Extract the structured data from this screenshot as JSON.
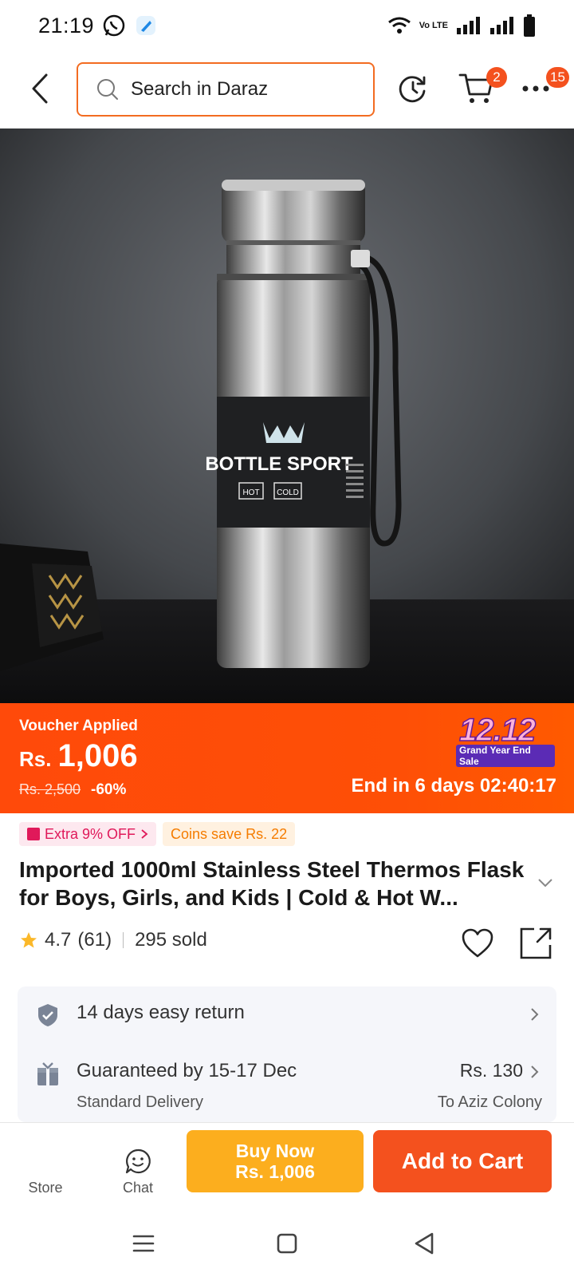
{
  "status": {
    "time": "21:19",
    "network_label": "Vo LTE"
  },
  "search": {
    "placeholder": "Search in Daraz"
  },
  "nav": {
    "cart_badge": "2",
    "more_badge": "15"
  },
  "product_image": {
    "bottle_brand": "BOTTLE SPORT",
    "hot_label": "HOT",
    "cold_label": "COLD"
  },
  "price": {
    "voucher_label": "Voucher Applied",
    "currency": "Rs.",
    "current": "1,006",
    "original": "Rs. 2,500",
    "discount": "-60%",
    "sale_name": "12.12",
    "sale_subtitle": "Grand Year End Sale",
    "countdown": "End in 6 days 02:40:17"
  },
  "promos": {
    "extra_off": "Extra 9% OFF",
    "coins": "Coins save Rs. 22"
  },
  "product": {
    "title": "Imported 1000ml Stainless Steel Thermos Flask for Boys, Girls, and Kids | Cold & Hot W...",
    "rating": "4.7",
    "reviews": "(61)",
    "sold": "295 sold"
  },
  "info": {
    "return_text": "14 days easy return",
    "delivery_text": "Guaranteed by 15-17 Dec",
    "delivery_fee": "Rs. 130",
    "delivery_type": "Standard Delivery",
    "delivery_location": "To Aziz Colony"
  },
  "actions": {
    "store": "Store",
    "chat": "Chat",
    "buy_now": "Buy Now",
    "buy_now_price": "Rs. 1,006",
    "add_to_cart": "Add to Cart"
  },
  "colors": {
    "brand_orange": "#f4511e",
    "buy_now_yellow": "#fcae1e",
    "price_banner": "#fe4f06"
  }
}
